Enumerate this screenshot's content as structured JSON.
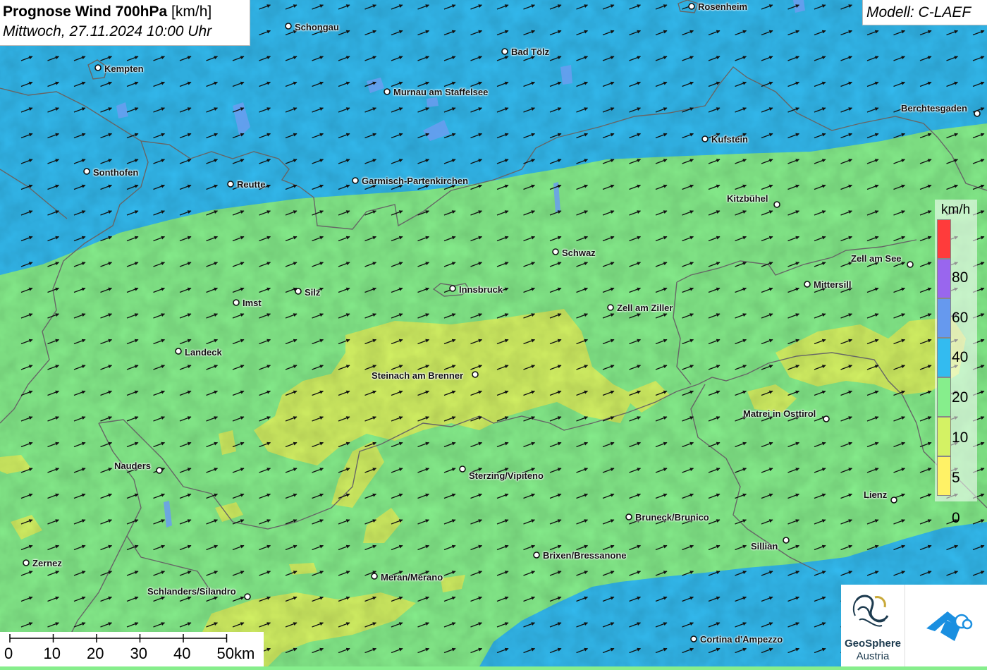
{
  "title": {
    "main_bold": "Prognose Wind 700hPa",
    "main_unit": "[km/h]",
    "subtitle": "Mittwoch, 27.11.2024 10:00 Uhr"
  },
  "model_label": "Modell: C-LAEF",
  "legend": {
    "unit": "km/h",
    "bins": [
      {
        "label": "",
        "color": "#ff3b3b"
      },
      {
        "label": "80",
        "color": "#9966ee"
      },
      {
        "label": "60",
        "color": "#6699ee"
      },
      {
        "label": "40",
        "color": "#33bbf0"
      },
      {
        "label": "20",
        "color": "#86ee8c"
      },
      {
        "label": "10",
        "color": "#d4f264"
      },
      {
        "label": "5",
        "color": "#fff266"
      },
      {
        "label": "0",
        "color": ""
      }
    ]
  },
  "scale_bar": {
    "ticks": [
      "0",
      "10",
      "20",
      "30",
      "40",
      "50km"
    ]
  },
  "cities": [
    {
      "name": "Rosenheim"
    },
    {
      "name": "Schongau"
    },
    {
      "name": "Bad Tölz"
    },
    {
      "name": "Kempten"
    },
    {
      "name": "Murnau am Staffelsee"
    },
    {
      "name": "Berchtesgaden"
    },
    {
      "name": "Kufstein"
    },
    {
      "name": "Sonthofen"
    },
    {
      "name": "Reutte"
    },
    {
      "name": "Garmisch-Partenkirchen"
    },
    {
      "name": "Kitzbühel"
    },
    {
      "name": "Schwaz"
    },
    {
      "name": "Zell am See"
    },
    {
      "name": "Mittersill"
    },
    {
      "name": "Silz"
    },
    {
      "name": "Innsbruck"
    },
    {
      "name": "Imst"
    },
    {
      "name": "Zell am Ziller"
    },
    {
      "name": "Landeck"
    },
    {
      "name": "Steinach am Brenner"
    },
    {
      "name": "Matrei in Osttirol"
    },
    {
      "name": "Nauders"
    },
    {
      "name": "Sterzing/Vipiteno"
    },
    {
      "name": "Lienz"
    },
    {
      "name": "Bruneck/Brunico"
    },
    {
      "name": "Sillian"
    },
    {
      "name": "Brixen/Bressanone"
    },
    {
      "name": "Zernez"
    },
    {
      "name": "Meran/Merano"
    },
    {
      "name": "Schlanders/Silandro"
    },
    {
      "name": "Cortina d'Ampezzo"
    }
  ],
  "logo": {
    "line1": "GeoSphere",
    "line2": "Austria"
  },
  "colors": {
    "wind_10_20": "#86ee8c",
    "wind_20_40": "#33bbf0",
    "wind_5_10": "#d4f264",
    "border": "#666666",
    "logo_blue": "#1a8fe0"
  },
  "icons": [
    "wind-arrow-icon",
    "city-marker-icon",
    "geosphere-logo-icon",
    "weather-app-logo-icon"
  ]
}
